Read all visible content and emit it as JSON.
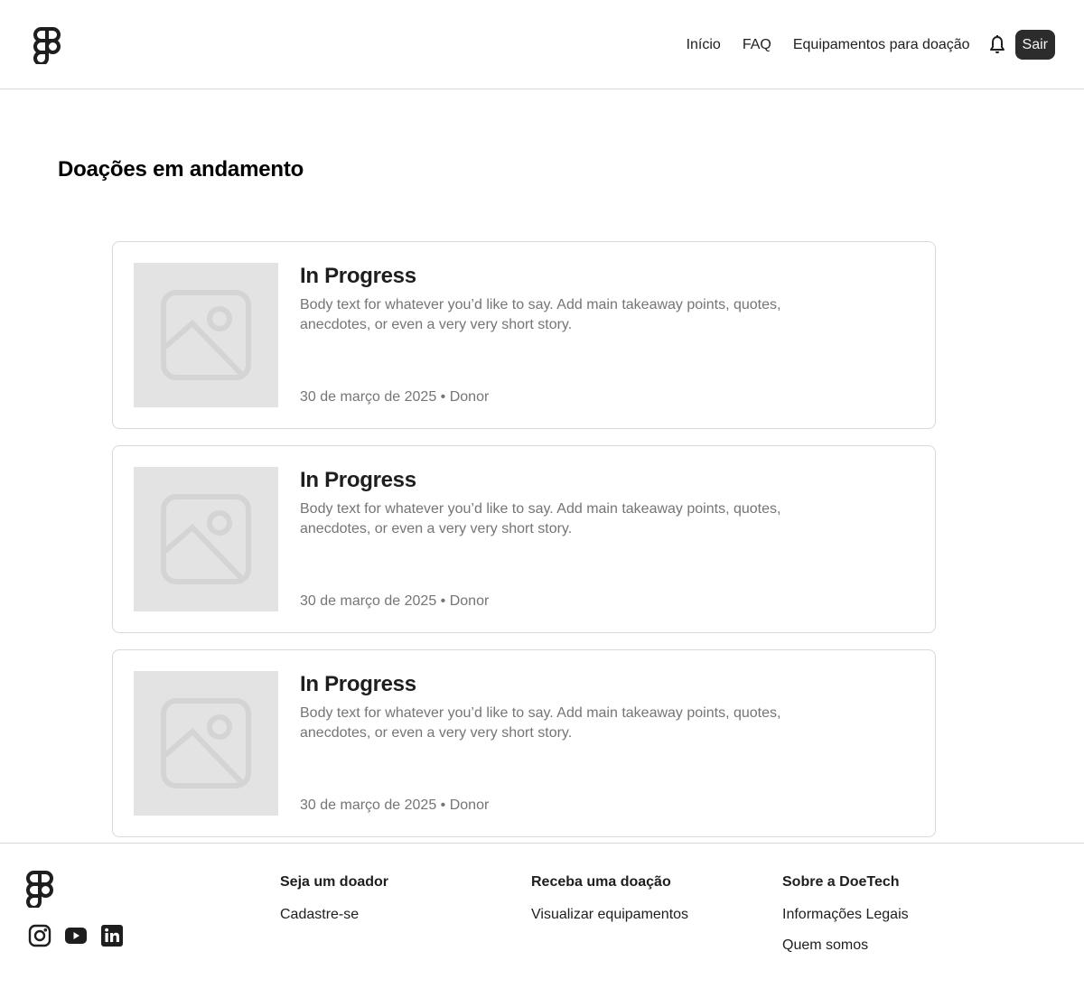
{
  "header": {
    "nav": [
      "Início",
      "FAQ",
      "Equipamentos para doação"
    ],
    "signout_label": "Sair"
  },
  "page": {
    "title": "Doações em andamento"
  },
  "cards": [
    {
      "title": "In Progress",
      "body": "Body text for whatever you’d like to say. Add main takeaway points, quotes, anecdotes, or even a very very short story.",
      "meta": "30 de março de 2025 • Donor"
    },
    {
      "title": "In Progress",
      "body": "Body text for whatever you’d like to say. Add main takeaway points, quotes, anecdotes, or even a very very short story.",
      "meta": "30 de março de 2025 • Donor"
    },
    {
      "title": "In Progress",
      "body": "Body text for whatever you’d like to say. Add main takeaway points, quotes, anecdotes, or even a very very short story.",
      "meta": "30 de março de 2025 • Donor"
    }
  ],
  "footer": {
    "social_icons": [
      "instagram-icon",
      "youtube-icon",
      "linkedin-icon"
    ],
    "columns": [
      {
        "title": "Seja um doador",
        "links": [
          "Cadastre-se"
        ]
      },
      {
        "title": "Receba uma doação",
        "links": [
          "Visualizar equipamentos"
        ]
      },
      {
        "title": "Sobre a DoeTech",
        "links": [
          "Informações Legais",
          "Quem somos"
        ]
      }
    ]
  },
  "colors": {
    "text": "#1e1e1e",
    "muted": "#757575",
    "border": "#d9d9d9",
    "button_bg": "#2c2c2c",
    "placeholder_bg": "#e3e3e3"
  }
}
